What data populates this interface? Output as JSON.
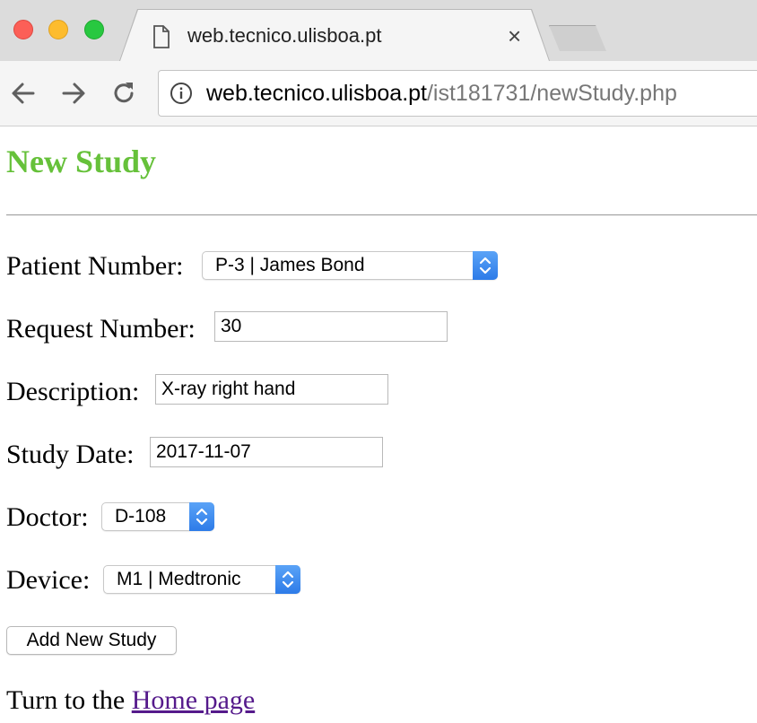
{
  "browser": {
    "tab_title": "web.tecnico.ulisboa.pt",
    "tab_close": "×",
    "url_host": "web.tecnico.ulisboa.pt",
    "url_path": "/ist181731/newStudy.php",
    "icons": [
      "back-arrow-icon",
      "forward-arrow-icon",
      "reload-icon",
      "info-icon",
      "document-icon",
      "close-icon"
    ]
  },
  "page": {
    "title": "New Study",
    "title_color": "#66c13a",
    "form": {
      "patient_label": "Patient Number:",
      "patient_value": "P-3 | James Bond",
      "request_label": "Request Number:",
      "request_value": "30",
      "description_label": "Description:",
      "description_value": "X-ray right hand",
      "date_label": "Study Date:",
      "date_value": "2017-11-07",
      "doctor_label": "Doctor:",
      "doctor_value": "D-108",
      "device_label": "Device:",
      "device_value": "M1 | Medtronic",
      "submit_label": "Add New Study"
    },
    "footer": {
      "text": "Turn to the ",
      "link_text": "Home page"
    }
  }
}
